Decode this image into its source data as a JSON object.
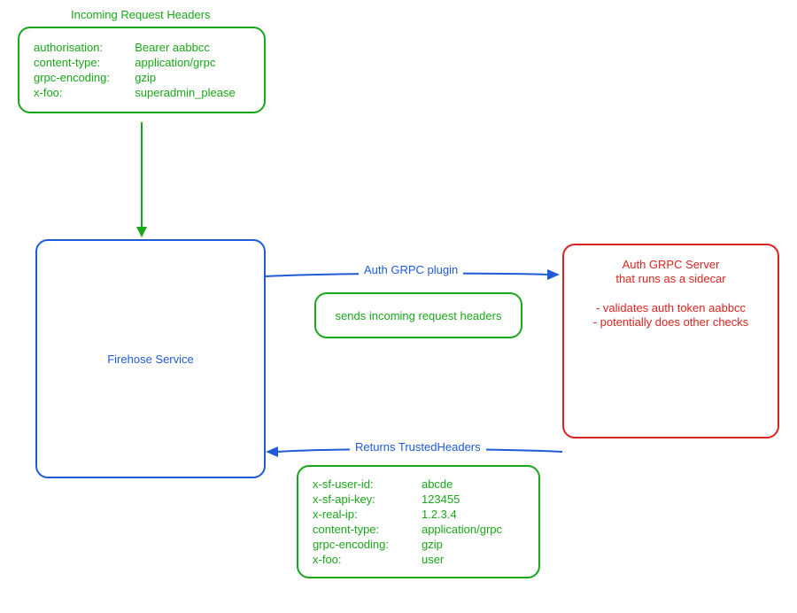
{
  "titles": {
    "incoming_headers": "Incoming Request Headers",
    "auth_plugin": "Auth GRPC plugin",
    "returns_trusted": "Returns TrustedHeaders",
    "firehose": "Firehose Service",
    "auth_server_l1": "Auth GRPC Server",
    "auth_server_l2": "that runs as a sidecar"
  },
  "incoming_headers": [
    {
      "k": "authorisation:",
      "v": "Bearer aabbcc"
    },
    {
      "k": "content-type:",
      "v": "application/grpc"
    },
    {
      "k": "grpc-encoding:",
      "v": "gzip"
    },
    {
      "k": "x-foo:",
      "v": "superadmin_please"
    }
  ],
  "note_sends": "sends incoming request headers",
  "auth_server_checks": [
    "- validates auth token aabbcc",
    "- potentially does other checks"
  ],
  "trusted_headers": [
    {
      "k": "x-sf-user-id:",
      "v": "abcde"
    },
    {
      "k": "x-sf-api-key:",
      "v": "123455"
    },
    {
      "k": "x-real-ip:",
      "v": "1.2.3.4"
    },
    {
      "k": "content-type:",
      "v": "application/grpc"
    },
    {
      "k": "grpc-encoding:",
      "v": "gzip"
    },
    {
      "k": "x-foo:",
      "v": "user"
    }
  ],
  "colors": {
    "green": "#19a619",
    "blue": "#1f5bd8",
    "red": "#d8241f"
  }
}
